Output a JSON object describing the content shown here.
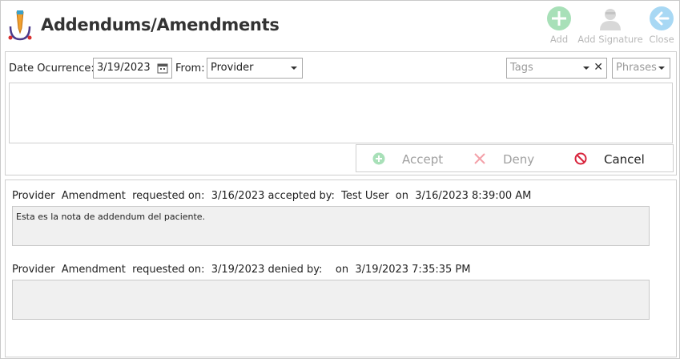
{
  "header": {
    "title": "Addendums/Amendments",
    "toolbar": {
      "add_label": "Add",
      "add_signature_label": "Add Signature",
      "close_label": "Close"
    }
  },
  "form": {
    "date_label": "Date Ocurrence:",
    "date_value": "3/19/2023",
    "from_label": "From:",
    "from_value": "Provider",
    "tags_placeholder": "Tags",
    "phrases_placeholder": "Phrases",
    "note_text": ""
  },
  "actions": {
    "accept_label": "Accept",
    "deny_label": "Deny",
    "cancel_label": "Cancel"
  },
  "history": [
    {
      "header": "Provider  Amendment  requested on:  3/16/2023 accepted by:  Test User  on  3/16/2023 8:39:00 AM",
      "body": "Esta es la nota de addendum del paciente."
    },
    {
      "header": "Provider  Amendment  requested on:  3/19/2023 denied by:    on  3/19/2023 7:35:35 PM",
      "body": ""
    }
  ],
  "colors": {
    "accent_green": "#8fd6a0",
    "accent_blue": "#8ecbf0",
    "cancel_red": "#d8243c",
    "deny_red": "#f3a0a8"
  }
}
